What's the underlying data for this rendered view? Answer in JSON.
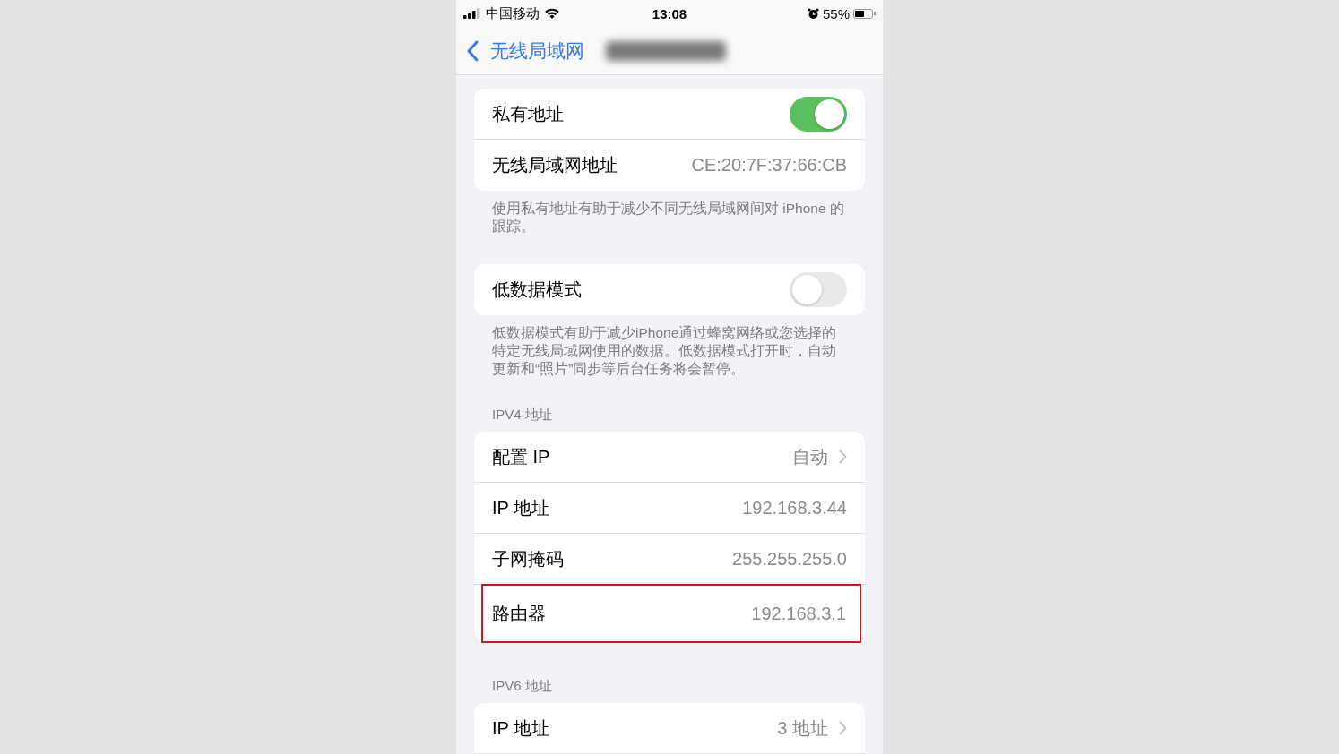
{
  "status_bar": {
    "carrier": "中国移动",
    "time": "13:08",
    "battery": "55%"
  },
  "nav": {
    "back": "无线局域网"
  },
  "sections": [
    {
      "rows": [
        {
          "kind": "toggle",
          "label": "私有地址",
          "on": true,
          "highlighted": false
        },
        {
          "kind": "value",
          "label": "无线局域网地址",
          "value": "CE:20:7F:37:66:CB",
          "highlighted": false
        }
      ],
      "footer": "使用私有地址有助于减少不同无线局域网间对 iPhone 的跟踪。"
    },
    {
      "rows": [
        {
          "kind": "toggle",
          "label": "低数据模式",
          "on": false,
          "highlighted": false
        }
      ],
      "footer": "低数据模式有助于减少iPhone通过蜂窝网络或您选择的特定无线局域网使用的数据。低数据模式打开时，自动更新和“照片”同步等后台任务将会暂停。"
    },
    {
      "header": "IPV4 地址",
      "rows": [
        {
          "kind": "disclosure",
          "label": "配置 IP",
          "value": "自动",
          "highlighted": false
        },
        {
          "kind": "value",
          "label": "IP 地址",
          "value": "192.168.3.44",
          "highlighted": false
        },
        {
          "kind": "value",
          "label": "子网掩码",
          "value": "255.255.255.0",
          "highlighted": false
        },
        {
          "kind": "value",
          "label": "路由器",
          "value": "192.168.3.1",
          "highlighted": true
        }
      ]
    },
    {
      "header": "IPV6 地址",
      "rows": [
        {
          "kind": "disclosure",
          "label": "IP 地址",
          "value": "3 地址",
          "highlighted": false
        }
      ]
    }
  ]
}
